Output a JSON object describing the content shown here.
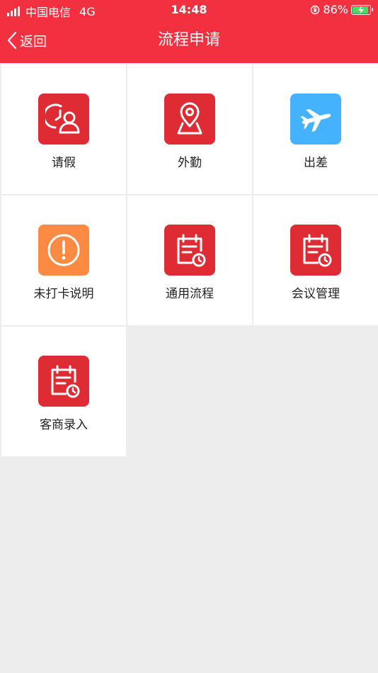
{
  "status_bar": {
    "carrier": "中国电信",
    "network": "4G",
    "time": "14:48",
    "battery": "86%"
  },
  "header": {
    "back_label": "返回",
    "title": "流程申请"
  },
  "colors": {
    "header_bg": "#f33040",
    "icon_red": "#df2b33",
    "icon_blue": "#45b2fd",
    "icon_orange": "#fd8a42"
  },
  "tiles": [
    {
      "label": "请假",
      "icon": "clock-person-icon",
      "color": "#df2b33"
    },
    {
      "label": "外勤",
      "icon": "location-pin-icon",
      "color": "#df2b33"
    },
    {
      "label": "出差",
      "icon": "airplane-icon",
      "color": "#45b2fd"
    },
    {
      "label": "未打卡说明",
      "icon": "exclamation-icon",
      "color": "#fd8a42"
    },
    {
      "label": "通用流程",
      "icon": "calendar-clock-icon",
      "color": "#df2b33"
    },
    {
      "label": "会议管理",
      "icon": "calendar-clock-icon",
      "color": "#df2b33"
    },
    {
      "label": "客商录入",
      "icon": "calendar-clock-icon",
      "color": "#df2b33"
    }
  ]
}
